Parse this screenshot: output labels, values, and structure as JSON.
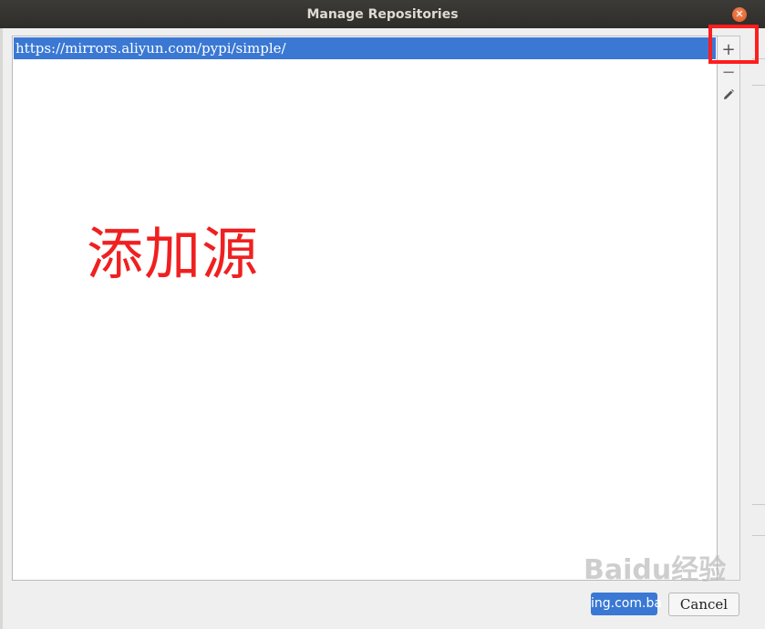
{
  "window": {
    "title": "Manage Repositories",
    "close_icon": "close-icon"
  },
  "repositories": {
    "items": [
      {
        "url": "https://mirrors.aliyun.com/pypi/simple/",
        "selected": true
      }
    ]
  },
  "toolbar": {
    "add_symbol": "+",
    "remove_symbol": "−",
    "edit_icon": "pencil-icon"
  },
  "annotation": {
    "text": "添加源",
    "color": "#f02020"
  },
  "buttons": {
    "ok_label": "ing.com.ba",
    "cancel_label": "Cancel"
  },
  "watermark": {
    "text": "Baidu经验"
  },
  "colors": {
    "accent": "#3a78d4",
    "highlight_box": "#ff1e1e"
  }
}
